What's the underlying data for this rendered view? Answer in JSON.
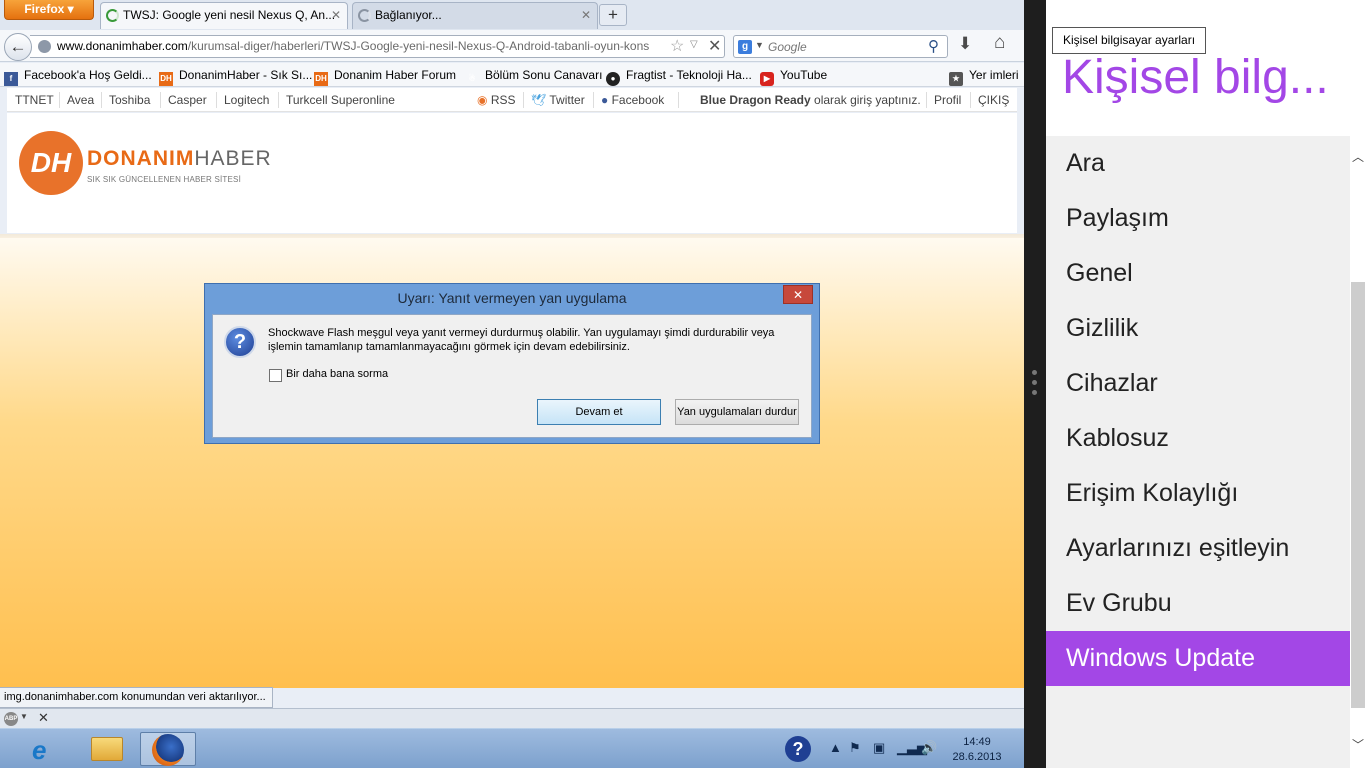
{
  "browser": {
    "menu_label": "Firefox",
    "tabs": [
      {
        "title": "TWSJ: Google yeni nesil Nexus Q, An..."
      },
      {
        "title": "Bağlanıyor..."
      }
    ],
    "new_tab": "+",
    "url_domain": "www.donanimhaber.com",
    "url_path": "/kurumsal-diger/haberleri/TWSJ-Google-yeni-nesil-Nexus-Q-Android-tabanli-oyun-kons",
    "search_placeholder": "Google",
    "bookmarks": [
      {
        "label": "Facebook'a Hoş Geldi...",
        "icon": "facebook-icon"
      },
      {
        "label": "DonanimHaber - Sık Sı...",
        "icon": "dh-icon"
      },
      {
        "label": "Donanim Haber Forum",
        "icon": "dh-icon"
      },
      {
        "label": "Bölüm Sonu Canavarı",
        "icon": "monster-icon"
      },
      {
        "label": "Fragtist - Teknoloji Ha...",
        "icon": "fragtist-icon"
      },
      {
        "label": "YouTube",
        "icon": "youtube-icon"
      }
    ],
    "bookmarks_menu": "Yer imleri",
    "status_text": "img.donanimhaber.com konumundan veri aktarılıyor..."
  },
  "site": {
    "nav_left": [
      "TTNET",
      "Avea",
      "Toshiba",
      "Casper",
      "Logitech",
      "Turkcell Superonline"
    ],
    "rss": "RSS",
    "twitter": "Twitter",
    "facebook": "Facebook",
    "user_name": "Blue Dragon Ready",
    "login_text": "olarak giriş yaptınız.",
    "profile": "Profil",
    "logout": "ÇIKIŞ",
    "logo_mark": "DH",
    "logo_word_a": "DONANIM",
    "logo_word_b": "HABER",
    "logo_tagline": "SIK SIK GÜNCELLENEN HABER SİTESİ"
  },
  "dialog": {
    "title": "Uyarı: Yanıt vermeyen yan uygulama",
    "close": "✕",
    "message": "Shockwave Flash meşgul veya yanıt vermeyi durdurmuş olabilir. Yan uygulamayı şimdi durdurabilir veya işlemin tamamlanıp tamamlanmayacağını görmek için devam edebilirsiniz.",
    "checkbox_label": "Bir daha bana sorma",
    "continue_button": "Devam et",
    "stop_button": "Yan uygulamaları durdur"
  },
  "taskbar": {
    "time": "14:49",
    "date": "28.6.2013"
  },
  "settings_pane": {
    "tooltip": "Kişisel bilgisayar ayarları",
    "title": "Kişisel bilg...",
    "items": [
      {
        "label": "Ara"
      },
      {
        "label": "Paylaşım"
      },
      {
        "label": "Genel"
      },
      {
        "label": "Gizlilik"
      },
      {
        "label": "Cihazlar"
      },
      {
        "label": "Kablosuz"
      },
      {
        "label": "Erişim Kolaylığı"
      },
      {
        "label": "Ayarlarınızı eşitleyin"
      },
      {
        "label": "Ev Grubu"
      },
      {
        "label": "Windows Update",
        "selected": true
      }
    ],
    "accent_color": "#a347e6"
  }
}
